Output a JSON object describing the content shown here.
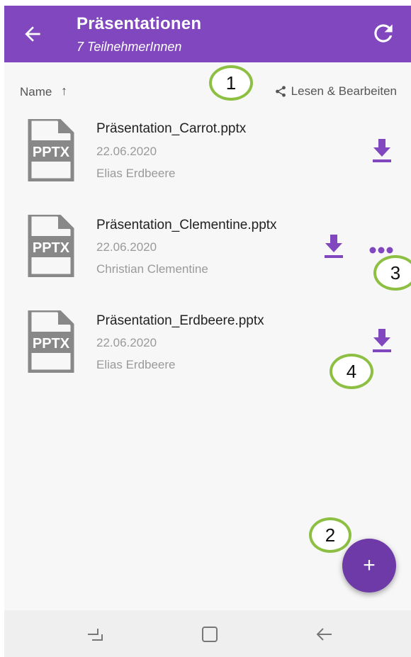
{
  "header": {
    "title": "Präsentationen",
    "subtitle": "7 TeilnehmerInnen",
    "back_icon": "arrow-left-icon",
    "refresh_icon": "refresh-icon",
    "background": "#8047bf"
  },
  "sortbar": {
    "sort_label": "Name",
    "sort_arrow": "↑",
    "permission_label": "Lesen & Bearbeiten",
    "permission_icon": "share-icon"
  },
  "files": [
    {
      "name": "Präsentation_Carrot.pptx",
      "date": "22.06.2020",
      "owner": "Elias Erdbeere",
      "icon_label": "PPTX"
    },
    {
      "name": "Präsentation_Clementine.pptx",
      "date": "22.06.2020",
      "owner": "Christian Clementine",
      "icon_label": "PPTX"
    },
    {
      "name": "Präsentation_Erdbeere.pptx",
      "date": "22.06.2020",
      "owner": "Elias Erdbeere",
      "icon_label": "PPTX"
    }
  ],
  "callouts": [
    "1",
    "2",
    "3",
    "4"
  ],
  "fab": {
    "label": "+",
    "color": "#6e3aa8"
  },
  "accent_color": "#8047bf",
  "callout_color": "#8dbf43"
}
